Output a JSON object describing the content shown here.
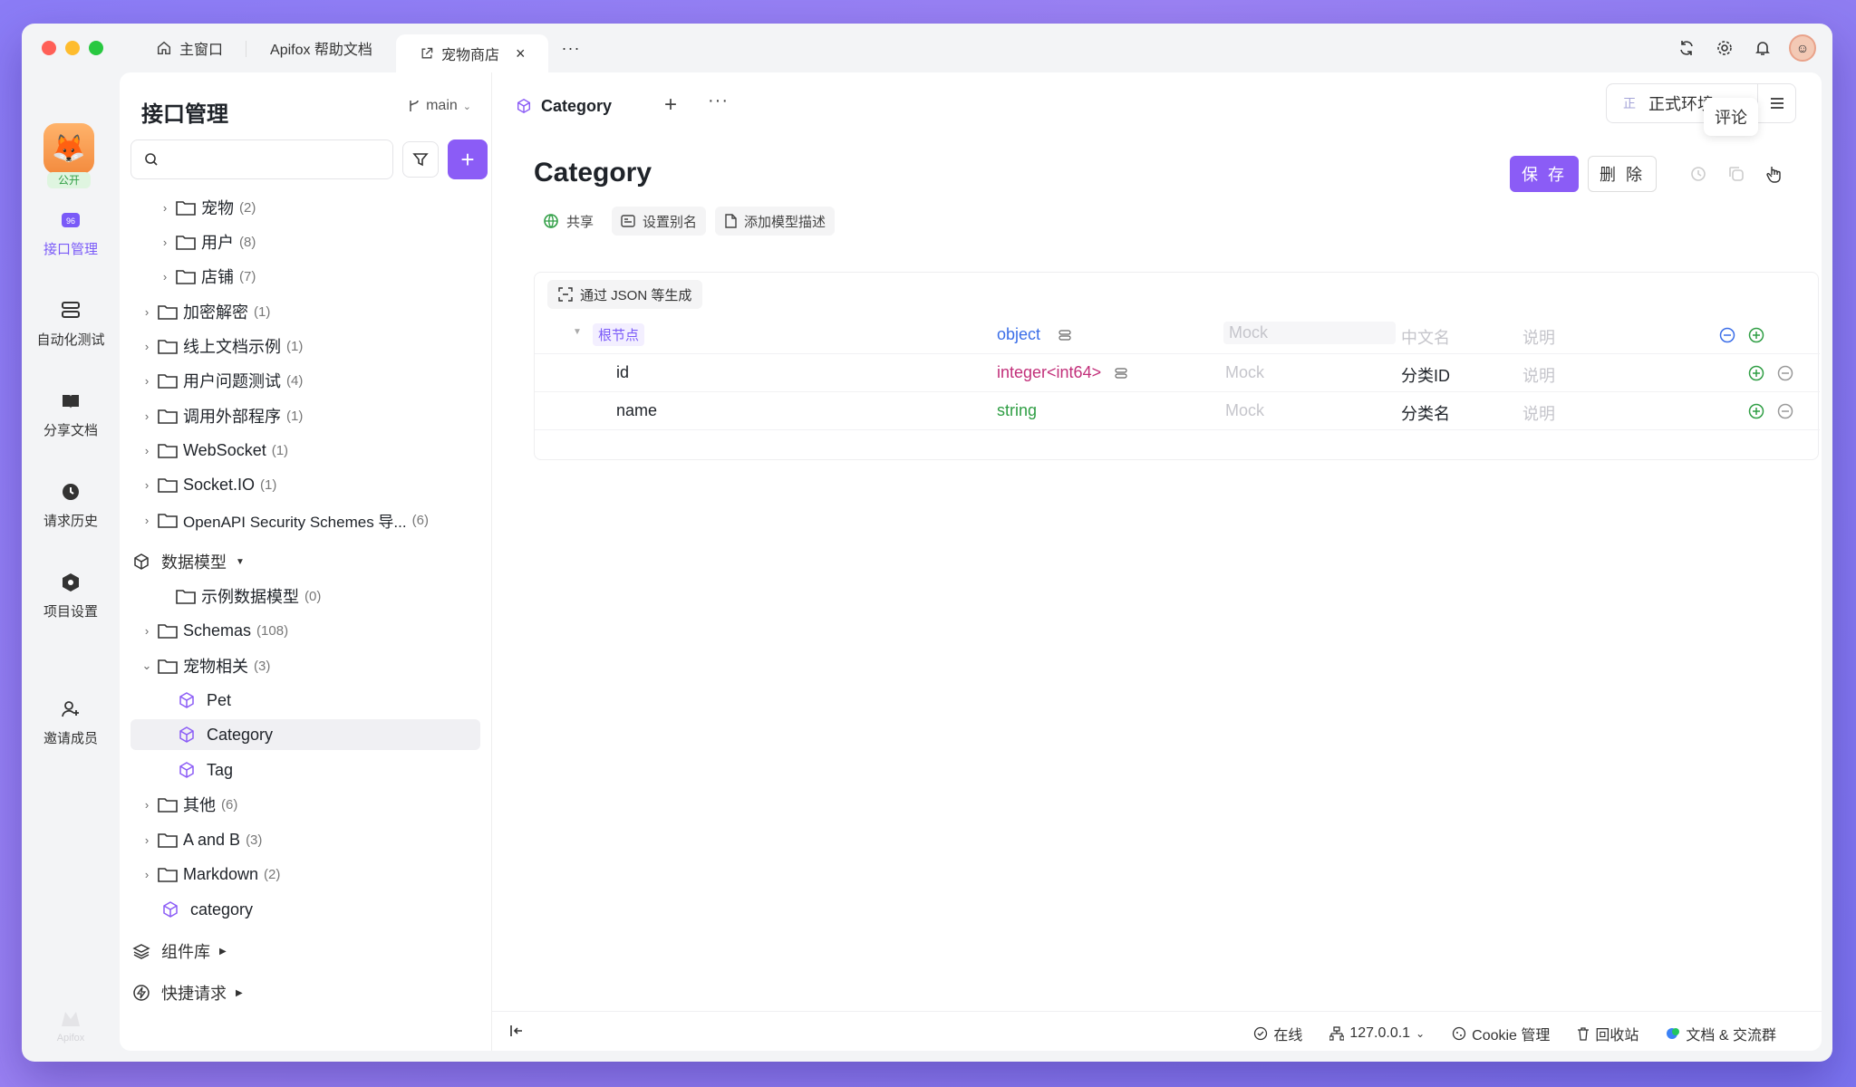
{
  "window_tabs": [
    {
      "label": "主窗口"
    },
    {
      "label": "Apifox 帮助文档"
    },
    {
      "label": "宠物商店"
    }
  ],
  "rail": {
    "badge": "公开",
    "items": [
      {
        "label": "接口管理"
      },
      {
        "label": "自动化测试"
      },
      {
        "label": "分享文档"
      },
      {
        "label": "请求历史"
      },
      {
        "label": "项目设置"
      },
      {
        "label": "邀请成员"
      }
    ],
    "footer": "Apifox"
  },
  "sidebar": {
    "title": "接口管理",
    "branch": "main",
    "search_placeholder": "",
    "tree": [
      {
        "label": "宠物",
        "count": "(2)"
      },
      {
        "label": "用户",
        "count": "(8)"
      },
      {
        "label": "店铺",
        "count": "(7)"
      },
      {
        "label": "加密解密",
        "count": "(1)"
      },
      {
        "label": "线上文档示例",
        "count": "(1)"
      },
      {
        "label": "用户问题测试",
        "count": "(4)"
      },
      {
        "label": "调用外部程序",
        "count": "(1)"
      },
      {
        "label": "WebSocket",
        "count": "(1)"
      },
      {
        "label": "Socket.IO",
        "count": "(1)"
      },
      {
        "label": "OpenAPI Security Schemes 导...",
        "count": "(6)"
      },
      {
        "label": "数据模型",
        "count": ""
      },
      {
        "label": "示例数据模型",
        "count": "(0)"
      },
      {
        "label": "Schemas",
        "count": "(108)"
      },
      {
        "label": "宠物相关",
        "count": "(3)"
      },
      {
        "label": "Pet",
        "count": ""
      },
      {
        "label": "Category",
        "count": ""
      },
      {
        "label": "Tag",
        "count": ""
      },
      {
        "label": "其他",
        "count": "(6)"
      },
      {
        "label": "A and B",
        "count": "(3)"
      },
      {
        "label": "Markdown",
        "count": "(2)"
      },
      {
        "label": "category",
        "count": ""
      },
      {
        "label": "组件库",
        "count": ""
      },
      {
        "label": "快捷请求",
        "count": ""
      }
    ]
  },
  "main": {
    "tab_label": "Category",
    "env_icon": "正",
    "env_label": "正式环境",
    "tooltip": "评论",
    "title": "Category",
    "save_label": "保 存",
    "delete_label": "删 除",
    "chips": [
      "共享",
      "设置别名",
      "添加模型描述"
    ],
    "json_gen_label": "通过 JSON 等生成",
    "schema_rows": [
      {
        "name": "根节点",
        "type": "object",
        "mock": "Mock",
        "cn_name": "中文名",
        "desc": "说明"
      },
      {
        "name": "id",
        "type": "integer<int64>",
        "mock": "Mock",
        "cn_name": "分类ID",
        "desc": "说明"
      },
      {
        "name": "name",
        "type": "string",
        "mock": "Mock",
        "cn_name": "分类名",
        "desc": "说明"
      }
    ]
  },
  "footer": {
    "online": "在线",
    "agent": "127.0.0.1",
    "cookie": "Cookie 管理",
    "recycle": "回收站",
    "docs": "文档 & 交流群"
  },
  "colors": {
    "accent": "#8b5cf6",
    "object_type": "#3b6ee8",
    "int_type": "#c2307a",
    "string_type": "#2f9e44"
  }
}
